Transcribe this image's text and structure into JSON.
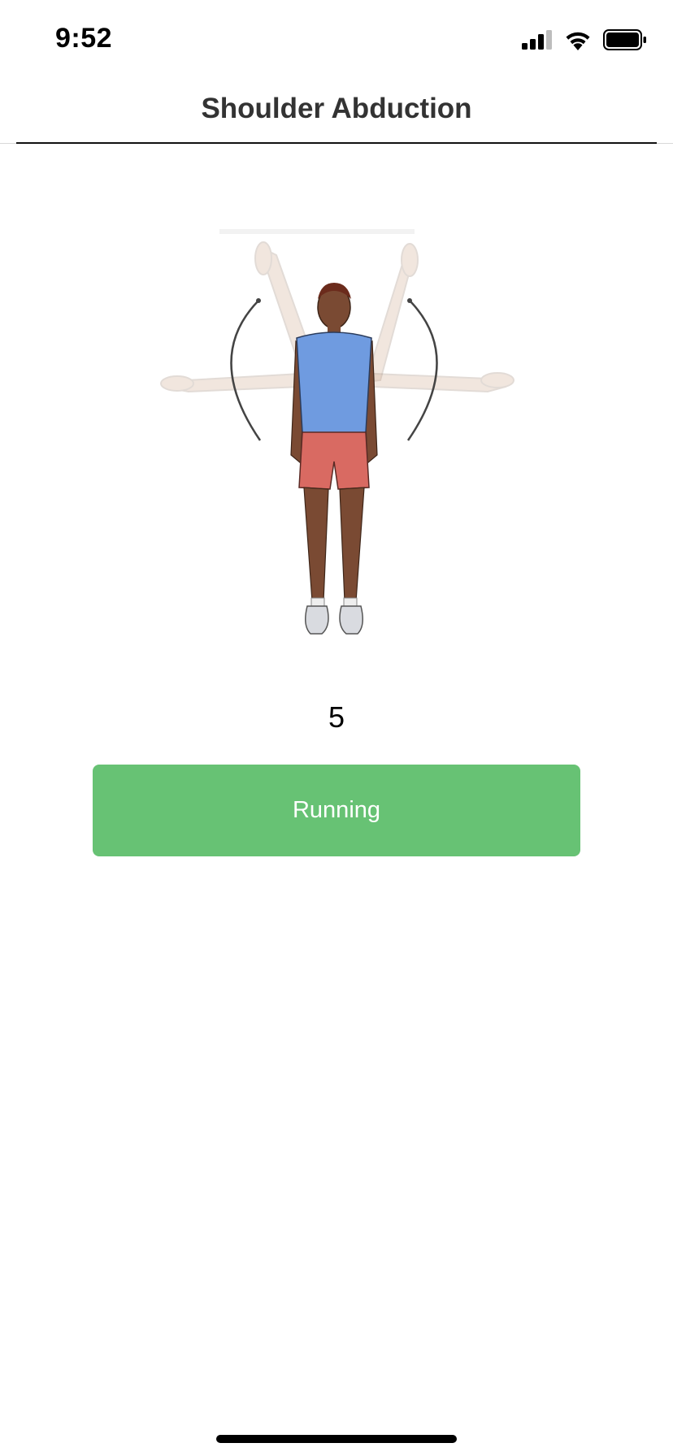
{
  "status_bar": {
    "time": "9:52",
    "icons": [
      "cellular-signal-icon",
      "wifi-icon",
      "battery-icon"
    ]
  },
  "header": {
    "title": "Shoulder Abduction"
  },
  "exercise": {
    "illustration": "shoulder-abduction-figure",
    "count": "5"
  },
  "action_button": {
    "label": "Running",
    "color": "#67c274"
  }
}
